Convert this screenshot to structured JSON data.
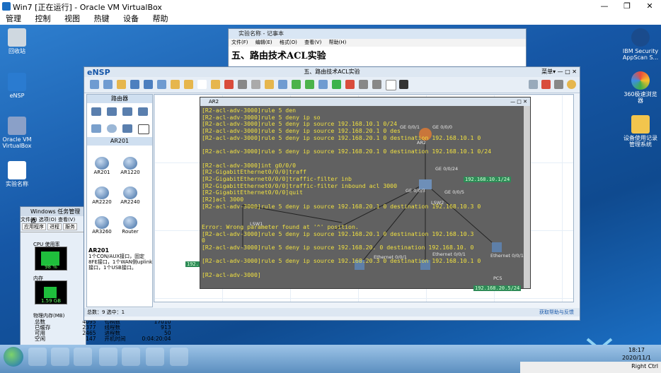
{
  "vbox": {
    "title": "Win7 [正在运行] - Oracle VM VirtualBox",
    "menu": [
      "管理",
      "控制",
      "视图",
      "热键",
      "设备",
      "帮助"
    ],
    "status_right": "Right Ctrl"
  },
  "desktop_icons": {
    "left": [
      "回收站",
      "eNSP",
      "Oracle VM VirtualBox",
      "实验名称"
    ],
    "right": [
      "IBM Security AppScan S...",
      "360极速浏览器",
      "设备使用记录管理系统"
    ]
  },
  "notepad": {
    "title": "实验名称 - 记事本",
    "menu": [
      "文件(F)",
      "编辑(E)",
      "格式(O)",
      "查看(V)",
      "帮助(H)"
    ],
    "content": "五、路由技术ACL实验"
  },
  "taskmgr": {
    "title": "Windows 任务管理器",
    "menu": [
      "文件(F)",
      "选项(O)",
      "查看(V)"
    ],
    "tabs": [
      "应用程序",
      "进程",
      "服务"
    ],
    "cpu_label": "CPU 使用率",
    "cpu_value": "98 %",
    "mem_label": "内存",
    "mem_value": "1.59 GB",
    "phys_label": "物理内存(MB)",
    "rows": [
      [
        "总数",
        "4095",
        "句柄数",
        "17010"
      ],
      [
        "已缓存",
        "2377",
        "线程数",
        "913"
      ],
      [
        "可用",
        "2465",
        "进程数",
        "50"
      ],
      [
        "空闲",
        "147",
        "开机时间",
        "0:04:20:04"
      ]
    ]
  },
  "ensp": {
    "logo": "eNSP",
    "title": "五、路由技术ACL实验",
    "menu_right": "菜单▾",
    "lib_header": "路由器",
    "lib_section": "AR201",
    "devices": [
      "AR201",
      "AR1220",
      "AR2220",
      "AR2240",
      "AR3260",
      "Router"
    ],
    "desc_title": "AR201",
    "desc_text": "1个CON/AUX接口，固定8FE接口，1个WAN侧uplink接口，1个USB接口。",
    "status_left": "总数：9  选中：1",
    "status_right": "获取帮助与反馈"
  },
  "terminal": {
    "title": "AR2",
    "lines": [
      "[R2-acl-adv-3000]rule 5 den",
      "[R2-acl-adv-3000]rule 5 deny ip so",
      "[R2-acl-adv-3000]rule 5 deny ip source 192.168.10.1 0/24",
      "[R2-acl-adv-3000]rule 5 deny ip source 192.168.20.1 0 des",
      "[R2-acl-adv-3000]rule 5 deny ip source 192.168.20.1 0 destination 192.168.10.1 0",
      "",
      "[R2-acl-adv-3000]rule 5 deny ip source 192.168.20.1 0 destination 192.168.10.1 0/24",
      "",
      "[R2-acl-adv-3000]int g0/0/0",
      "[R2-GigabitEthernet0/0/0]traff",
      "[R2-GigabitEthernet0/0/0]traffic-filter inb",
      "[R2-GigabitEthernet0/0/0]traffic-filter inbound acl 3000",
      "[R2-GigabitEthernet0/0/0]quit",
      "[R2]acl 3000",
      "[R2-acl-adv-3000]rule 5 deny ip source 192.168.20.1 0 destination 192.168.10.3 0",
      "",
      "",
      "Error: Wrong parameter found at '^' position.",
      "[R2-acl-adv-3000]rule 5 deny ip source 192.168.20.1 0 destination 192.168.10.3",
      "0",
      "[R2-acl-adv-3000]rule 5 deny ip source 192.168.20. 0 destination 192.168.10. 0",
      "",
      "[R2-acl-adv-3000]rule 5 deny ip source 192.168.20.3 0 destination 192.168.10.1 0",
      "",
      "[R2-acl-adv-3000]"
    ],
    "topo_labels": [
      "GE 0/0/1",
      "AR2",
      "GE 0/0/0",
      "GE 0/0/24",
      "GE 0/0/3",
      "GE 0/0/5",
      "LSW2",
      "LSW1",
      "Ethernet 0/0/1",
      "Ethernet 0/0/1",
      "Ethernet 0/0/1",
      "PC5"
    ],
    "green_tags": [
      "192.168.20.5/24",
      "192.",
      "192.168.10.1/24"
    ]
  },
  "clock": {
    "time": "18:17",
    "date": "2020/11/1"
  }
}
